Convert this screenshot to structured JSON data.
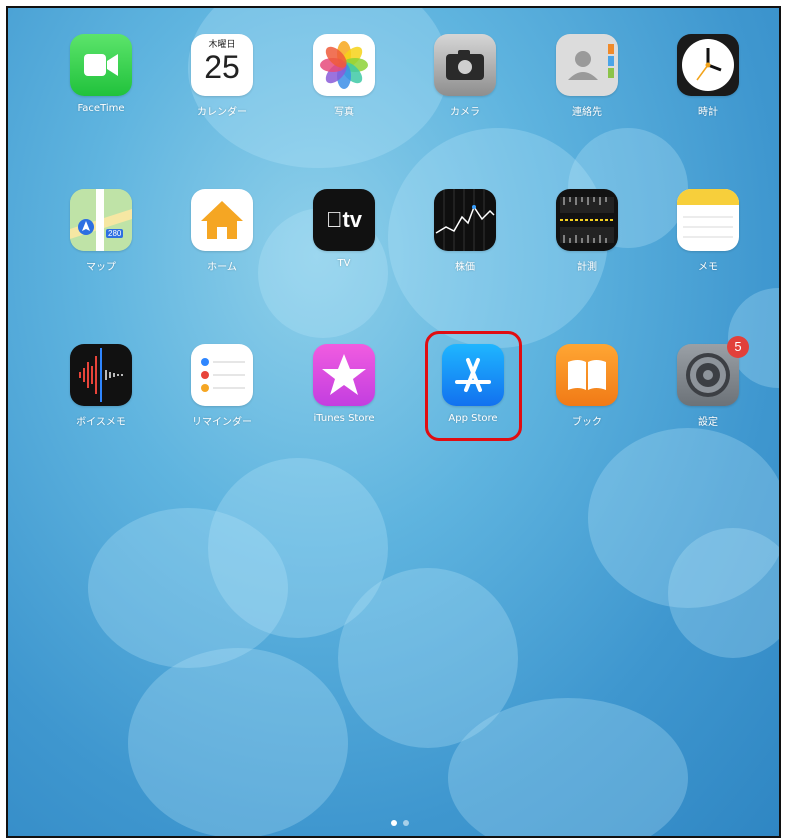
{
  "apps": [
    {
      "id": "facetime",
      "label": "FaceTime",
      "icon": "facetime-video-icon"
    },
    {
      "id": "calendar",
      "label": "カレンダー",
      "icon": "calendar-icon",
      "weekday": "木曜日",
      "day": "25"
    },
    {
      "id": "photos",
      "label": "写真",
      "icon": "photos-flower-icon"
    },
    {
      "id": "camera",
      "label": "カメラ",
      "icon": "camera-icon"
    },
    {
      "id": "contacts",
      "label": "連絡先",
      "icon": "contacts-icon"
    },
    {
      "id": "clock",
      "label": "時計",
      "icon": "clock-icon"
    },
    {
      "id": "maps",
      "label": "マップ",
      "icon": "maps-icon",
      "route_sign": "280"
    },
    {
      "id": "home",
      "label": "ホーム",
      "icon": "home-house-icon"
    },
    {
      "id": "tv",
      "label": "TV",
      "icon": "apple-tv-icon",
      "glyph": "tv"
    },
    {
      "id": "stocks",
      "label": "株価",
      "icon": "stocks-chart-icon"
    },
    {
      "id": "measure",
      "label": "計測",
      "icon": "measure-ruler-icon"
    },
    {
      "id": "notes",
      "label": "メモ",
      "icon": "notes-icon"
    },
    {
      "id": "voicememo",
      "label": "ボイスメモ",
      "icon": "voice-memo-waveform-icon"
    },
    {
      "id": "reminders",
      "label": "リマインダー",
      "icon": "reminders-list-icon"
    },
    {
      "id": "itunes",
      "label": "iTunes Store",
      "icon": "itunes-star-icon"
    },
    {
      "id": "appstore",
      "label": "App Store",
      "icon": "app-store-icon",
      "highlighted": true
    },
    {
      "id": "books",
      "label": "ブック",
      "icon": "books-icon"
    },
    {
      "id": "settings",
      "label": "設定",
      "icon": "settings-gear-icon",
      "badge": "5"
    }
  ],
  "page_indicator": {
    "count": 2,
    "current": 1
  },
  "colors": {
    "highlight_border": "#e00d12",
    "badge": "#e2403a",
    "wallpaper": "#3f97cf"
  }
}
